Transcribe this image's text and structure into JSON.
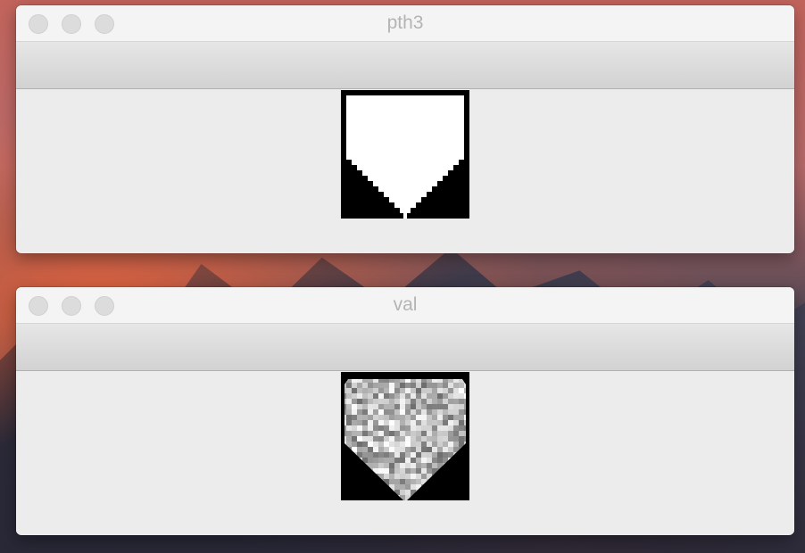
{
  "windows": [
    {
      "title": "pth3",
      "image": "pth3-mask-image"
    },
    {
      "title": "val",
      "image": "val-noise-image"
    }
  ],
  "colors": {
    "window_bg": "#ececec",
    "title_text": "#b4b4b4",
    "traffic_light": "#dcdcdc"
  }
}
